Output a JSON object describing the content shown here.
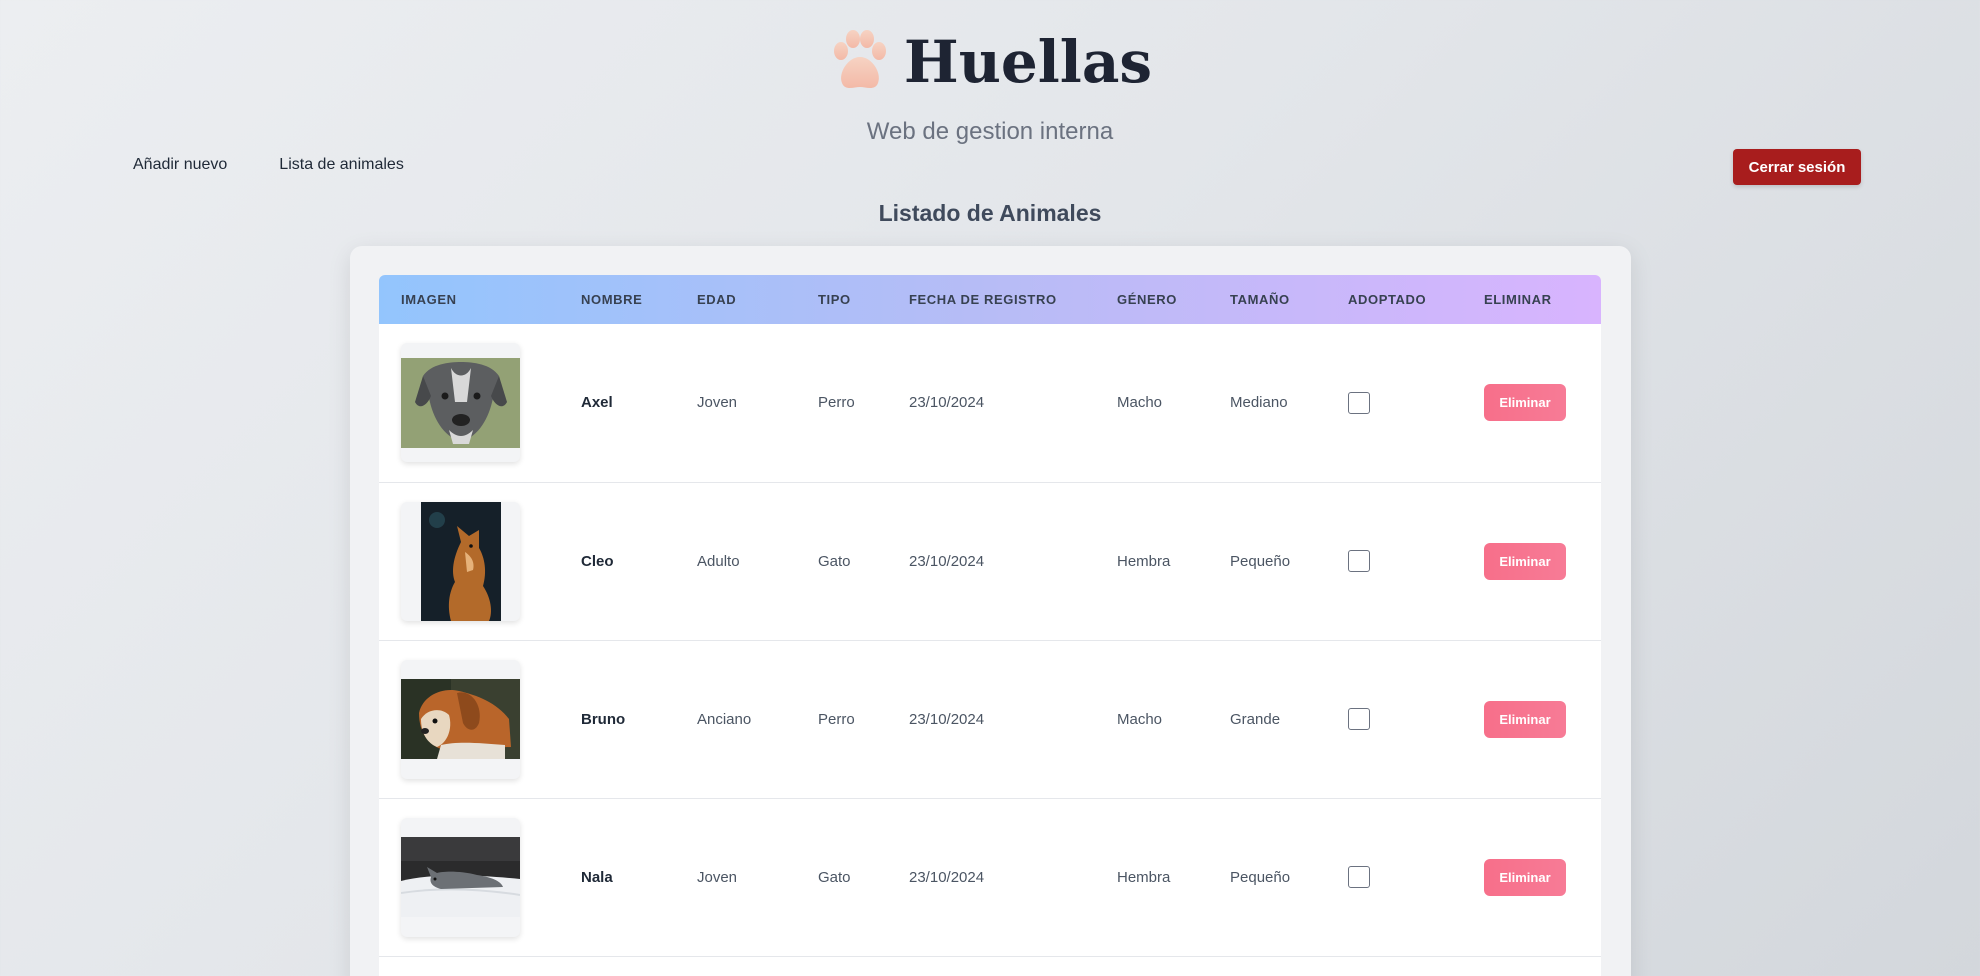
{
  "app": {
    "title": "Huellas",
    "subtitle": "Web de gestion interna",
    "logo_icon": "paw-icon",
    "accent": "#a81d1d"
  },
  "nav": {
    "items": [
      {
        "label": "Añadir nuevo"
      },
      {
        "label": "Lista de animales"
      }
    ],
    "logout_label": "Cerrar sesión"
  },
  "page": {
    "heading": "Listado de Animales"
  },
  "table": {
    "columns": [
      "IMAGEN",
      "NOMBRE",
      "EDAD",
      "TIPO",
      "FECHA DE REGISTRO",
      "GÉNERO",
      "TAMAÑO",
      "ADOPTADO",
      "ELIMINAR"
    ],
    "delete_label": "Eliminar",
    "rows": [
      {
        "image": "dog-photo",
        "nombre": "Axel",
        "edad": "Joven",
        "tipo": "Perro",
        "fecha": "23/10/2024",
        "genero": "Macho",
        "tamano": "Mediano",
        "adoptado": false
      },
      {
        "image": "cat-photo",
        "nombre": "Cleo",
        "edad": "Adulto",
        "tipo": "Gato",
        "fecha": "23/10/2024",
        "genero": "Hembra",
        "tamano": "Pequeño",
        "adoptado": false
      },
      {
        "image": "dog-photo",
        "nombre": "Bruno",
        "edad": "Anciano",
        "tipo": "Perro",
        "fecha": "23/10/2024",
        "genero": "Macho",
        "tamano": "Grande",
        "adoptado": false
      },
      {
        "image": "cat-photo",
        "nombre": "Nala",
        "edad": "Joven",
        "tipo": "Gato",
        "fecha": "23/10/2024",
        "genero": "Hembra",
        "tamano": "Pequeño",
        "adoptado": false
      }
    ]
  }
}
